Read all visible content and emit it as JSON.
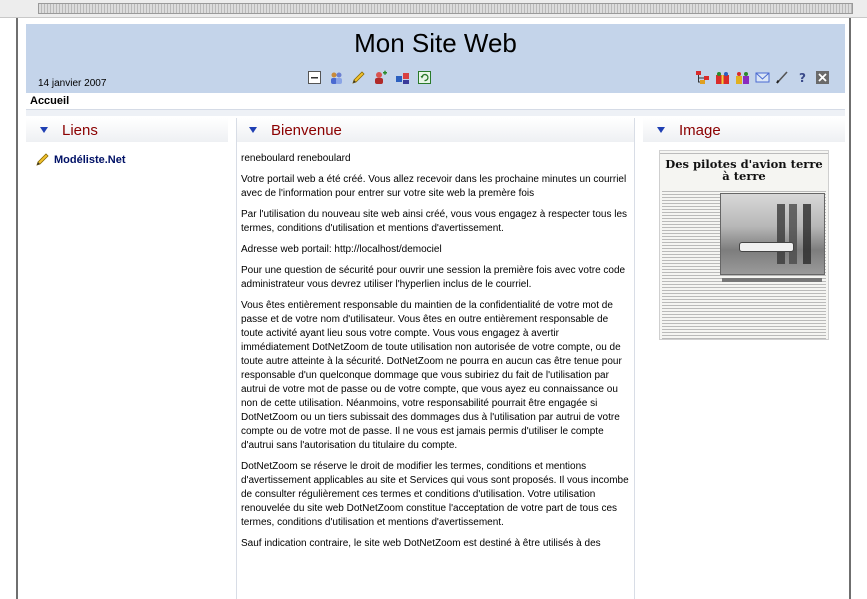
{
  "header": {
    "site_title": "Mon Site Web",
    "date": "14 janvier 2007",
    "center_icons": [
      "minimize-icon",
      "users-icon",
      "pencil-icon",
      "user-add-icon",
      "network-icon",
      "refresh-icon"
    ],
    "right_icons": [
      "site-tree-icon",
      "gift-icon",
      "group-icon",
      "mail-icon",
      "edit-icon",
      "help-icon",
      "close-icon"
    ]
  },
  "breadcrumb": {
    "home": "Accueil"
  },
  "left_pane": {
    "title": "Liens",
    "links": [
      {
        "label": "Modéliste.Net",
        "icon": "pencil-icon"
      }
    ]
  },
  "middle_pane": {
    "title": "Bienvenue",
    "paragraphs": [
      "reneboulard reneboulard",
      "Votre portail web a été créé. Vous allez recevoir dans les prochaine minutes un courriel avec de l'information pour entrer sur votre site web la premère fois",
      "Par l'utilisation du nouveau site web ainsi créé, vous vous engagez à respecter tous les termes, conditions d'utilisation et mentions d'avertissement.",
      "Adresse web portail: http://localhost/demociel",
      "Pour une question de sécurité pour ouvrir une session la première fois avec votre code administrateur vous devrez utiliser l'hyperlien inclus de le courriel.",
      "Vous êtes entièrement responsable du maintien de la confidentialité de votre mot de passe et de votre nom d'utilisateur. Vous êtes en outre entièrement responsable de toute activité ayant lieu sous votre compte. Vous vous engagez à avertir immédiatement DotNetZoom de toute utilisation non autorisée de votre compte, ou de toute autre atteinte à la sécurité. DotNetZoom ne pourra en aucun cas être tenue pour responsable d'un quelconque dommage que vous subiriez du fait de l'utilisation par autrui de votre mot de passe ou de votre compte, que vous ayez eu connaissance ou non de cette utilisation. Néanmoins, votre responsabilité pourrait être engagée si DotNetZoom ou un tiers subissait des dommages dus à l'utilisation par autrui de votre compte ou de votre mot de passe. Il ne vous est jamais permis d'utiliser le compte d'autrui sans l'autorisation du titulaire du compte.",
      "DotNetZoom se réserve le droit de modifier les termes, conditions et mentions d'avertissement applicables au site et Services qui vous sont proposés. Il vous incombe de consulter régulièrement ces termes et conditions d'utilisation. Votre utilisation renouvelée du site web DotNetZoom constitue l'acceptation de votre part de tous ces termes, conditions d'utilisation et mentions d'avertissement.",
      "Sauf indication contraire, le site web DotNetZoom est destiné à être utilisés à des"
    ]
  },
  "right_pane": {
    "title": "Image",
    "newspaper": {
      "headline": "Des pilotes d'avion terre à terre"
    }
  },
  "colors": {
    "header_bg": "#c4d4ea",
    "pane_title": "#8b0000",
    "triangle": "#1f3fb3",
    "link": "#001166"
  }
}
